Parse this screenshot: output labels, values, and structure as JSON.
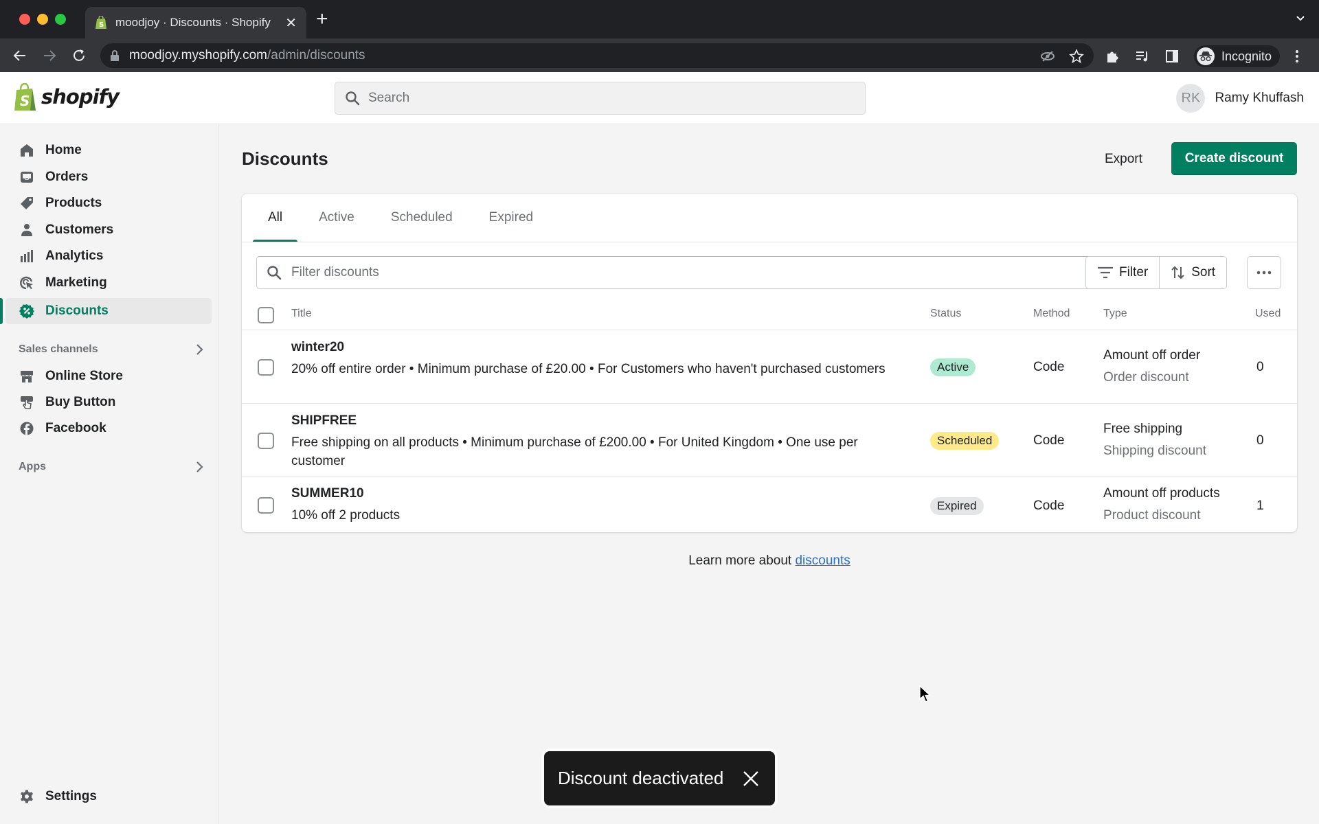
{
  "browser": {
    "tab_title": "moodjoy · Discounts · Shopify",
    "url_host": "moodjoy.myshopify.com",
    "url_path": "/admin/discounts",
    "profile_label": "Incognito"
  },
  "topbar": {
    "logo_text": "shopify",
    "search_placeholder": "Search",
    "user_initials": "RK",
    "user_name": "Ramy Khuffash"
  },
  "sidebar": {
    "items": [
      {
        "label": "Home",
        "icon": "home-icon"
      },
      {
        "label": "Orders",
        "icon": "inbox-icon"
      },
      {
        "label": "Products",
        "icon": "tag-icon"
      },
      {
        "label": "Customers",
        "icon": "person-icon"
      },
      {
        "label": "Analytics",
        "icon": "bar-chart-icon"
      },
      {
        "label": "Marketing",
        "icon": "target-icon"
      },
      {
        "label": "Discounts",
        "icon": "discount-icon",
        "selected": true
      }
    ],
    "sales_channels_label": "Sales channels",
    "channels": [
      {
        "label": "Online Store",
        "icon": "store-icon"
      },
      {
        "label": "Buy Button",
        "icon": "buy-button-icon"
      },
      {
        "label": "Facebook",
        "icon": "facebook-icon"
      }
    ],
    "apps_label": "Apps",
    "settings_label": "Settings"
  },
  "page": {
    "title": "Discounts",
    "export_label": "Export",
    "create_label": "Create discount",
    "tabs": [
      {
        "label": "All",
        "active": true
      },
      {
        "label": "Active"
      },
      {
        "label": "Scheduled"
      },
      {
        "label": "Expired"
      }
    ],
    "filter_placeholder": "Filter discounts",
    "filter_label": "Filter",
    "sort_label": "Sort",
    "columns": {
      "title": "Title",
      "status": "Status",
      "method": "Method",
      "type": "Type",
      "used": "Used"
    },
    "rows": [
      {
        "title": "winter20",
        "description": "20% off entire order • Minimum purchase of £20.00 • For Customers who haven't purchased customers",
        "status": "Active",
        "method": "Code",
        "type": "Amount off order",
        "subtype": "Order discount",
        "used": "0"
      },
      {
        "title": "SHIPFREE",
        "description": "Free shipping on all products • Minimum purchase of £200.00 • For United Kingdom • One use per customer",
        "status": "Scheduled",
        "method": "Code",
        "type": "Free shipping",
        "subtype": "Shipping discount",
        "used": "0"
      },
      {
        "title": "SUMMER10",
        "description": "10% off 2 products",
        "status": "Expired",
        "method": "Code",
        "type": "Amount off products",
        "subtype": "Product discount",
        "used": "1"
      }
    ],
    "learn_more_prefix": "Learn more about ",
    "learn_more_link": "discounts"
  },
  "toast": {
    "message": "Discount deactivated"
  },
  "colors": {
    "brand_green": "#008060",
    "badge_active": "#aee9d1",
    "badge_scheduled": "#ffea8a",
    "badge_expired": "#e4e5e7",
    "link": "#2c6ecb"
  }
}
